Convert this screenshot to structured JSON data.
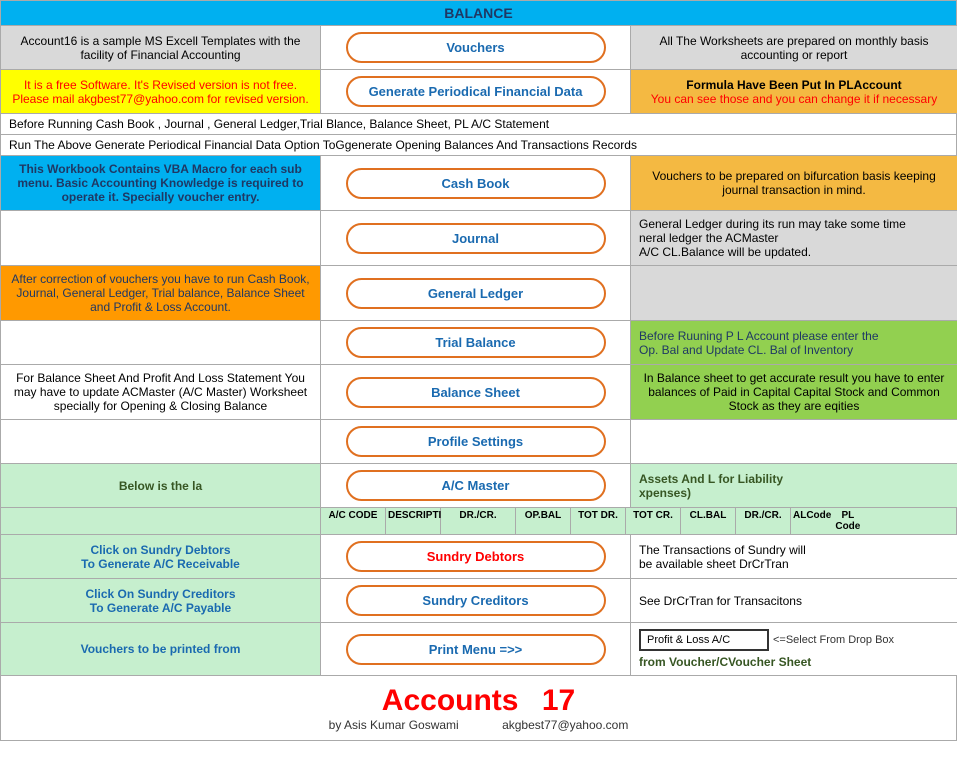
{
  "title": "BALANCE",
  "header": {
    "balance_label": "BALANCE"
  },
  "row1": {
    "left": "Account16 is a sample MS Excell Templates with the facility of Financial Accounting",
    "center_btn": "Vouchers",
    "right": "All The Worksheets are prepared on monthly basis accounting or report"
  },
  "row2": {
    "left": "It is a free Software. It's Revised version is not free.  Please mail akgbest77@yahoo.com for revised version.",
    "center_btn": "Generate Periodical Financial Data",
    "right_line1": "Formula Have Been Put In PLAccount",
    "right_line2": "You can see those and you can change it if necessary"
  },
  "info_text1": "Before Running Cash Book , Journal , General Ledger,Trial Blance, Balance Sheet, PL A/C Statement",
  "info_text2": "Run The Above Generate Periodical Financial Data Option ToGgenerate Opening Balances And Transactions Records",
  "row3": {
    "left": "This Workbook Contains VBA Macro for each sub menu. Basic Accounting Knowledge is required to operate it. Specially voucher entry.",
    "center_btn": "Cash Book",
    "right": "Vouchers to be prepared on bifurcation basis keeping journal transaction in mind."
  },
  "row4": {
    "left": "",
    "center_btn": "Journal",
    "right_line1": "General Ledger during its run may take some time",
    "right_line2": "neral ledger the ACMaster",
    "right_line3": "A/C CL.Balance will be updated."
  },
  "row5": {
    "left": "After correction of vouchers you have to run Cash Book, Journal, General Ledger, Trial balance, Balance Sheet and Profit & Loss Account.",
    "center_btn": "General Ledger",
    "right": ""
  },
  "row6": {
    "left": "",
    "center_btn": "Trial Balance",
    "right_line1": "Before Ruuning P L Account please enter the",
    "right_line2": "Op. Bal and Update CL. Bal of Inventory"
  },
  "row7": {
    "left": "For Balance Sheet And Profit And Loss Statement You may have to update ACMaster (A/C Master) Worksheet specially for Opening & Closing Balance",
    "center_btn": "Balance Sheet",
    "right": "In Balance sheet to get accurate result you have to enter balances of Paid in Capital Capital Stock and Common Stock as they are eqities"
  },
  "row8": {
    "center_btn": "Profile Settings"
  },
  "row9": {
    "left_line1": "Below is the la",
    "center_btn": "A/C Master",
    "right_line1": "Assets And L for Liability",
    "right_line2": "xpenses)"
  },
  "acmaster_table_headers": [
    "A/C CODE",
    "DESCRIPTI",
    "DR./CR.",
    "OP.BAL",
    "TOT DR.",
    "TOT CR.",
    "CL.BAL",
    "DR./CR.",
    "ALCode",
    "PL Code"
  ],
  "row_sundry_debtors": {
    "left_line1": "Click on Sundry Debtors",
    "left_line2": "To Generate A/C Receivable",
    "center_btn": "Sundry Debtors",
    "right_line1": "The Transactions of Sundry will",
    "right_line2": "be available sheet DrCrTran"
  },
  "row_sundry_creditors": {
    "left_line1": "Click On Sundry Creditors",
    "left_line2": "To Generate A/C Payable",
    "center_btn": "Sundry Creditors",
    "right_line1": "See DrCrTran for Transacitons"
  },
  "row_print": {
    "left": "Vouchers to be printed from",
    "center_btn": "Print Menu =>>",
    "dropdown_label": "Profit & Loss A/C",
    "dropdown_note": "<=Select From Drop Box",
    "right_note": "from Voucher/CVoucher Sheet"
  },
  "footer": {
    "title_accounts": "Accounts",
    "title_number": "17",
    "byline": "by Asis Kumar Goswami",
    "email": "akgbest77@yahoo.com"
  }
}
